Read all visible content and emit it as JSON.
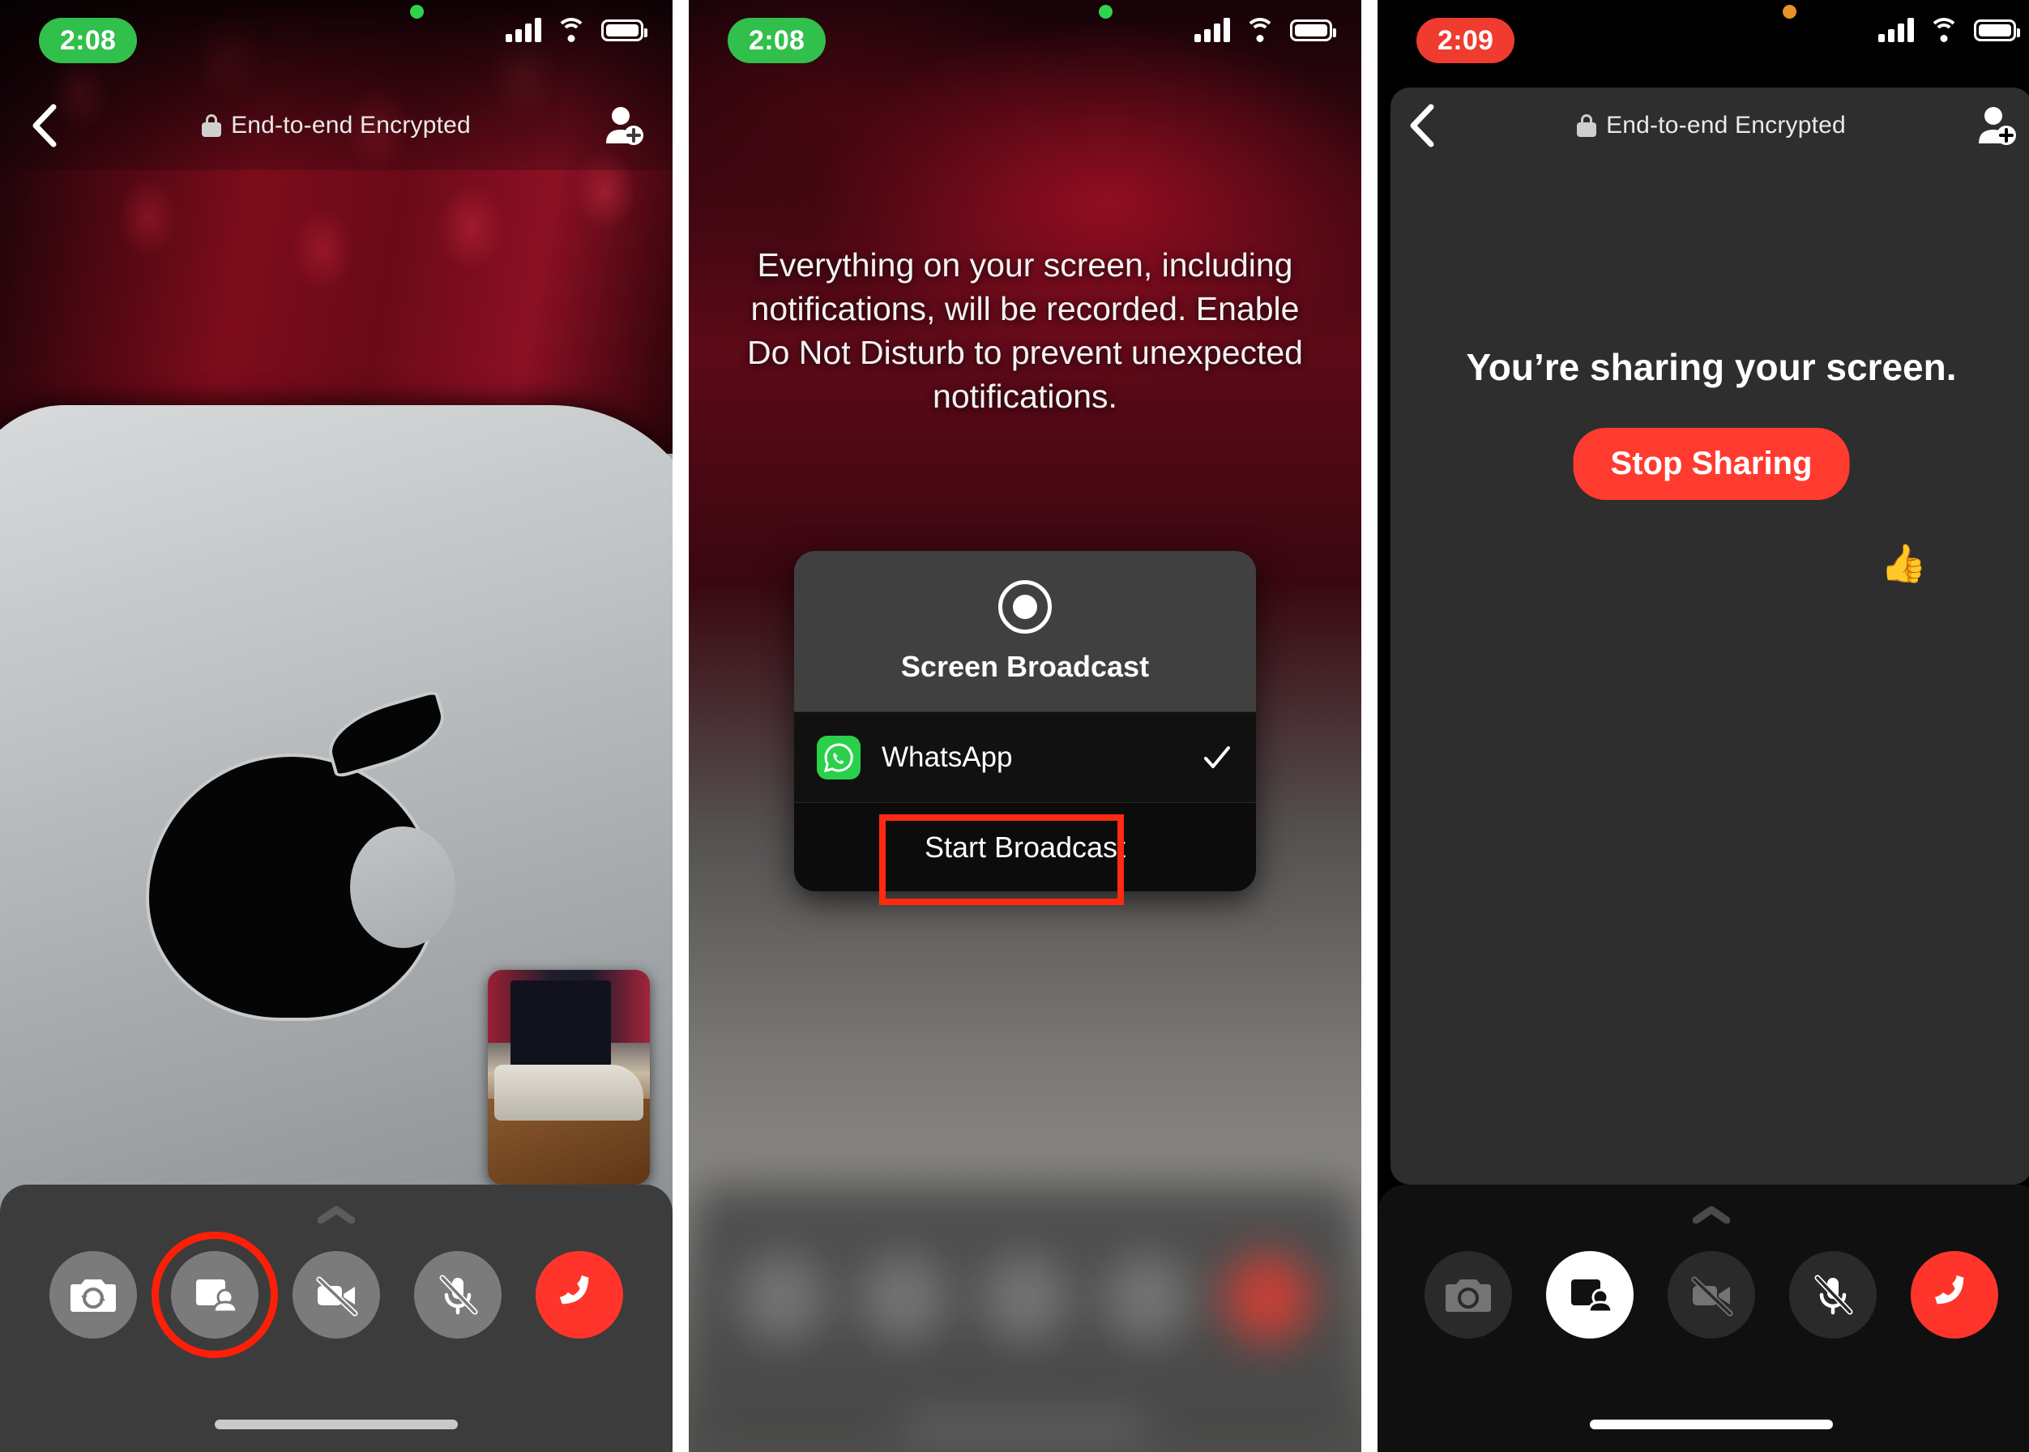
{
  "panels": [
    {
      "id": "call-screen",
      "status": {
        "time": "2:08",
        "time_pill_color": "#31c04b",
        "privacy_dot": "green",
        "icons": [
          "cellular-signal",
          "wifi",
          "battery"
        ]
      },
      "nav": {
        "back": "back-chevron",
        "lock": "lock-icon",
        "title": "End-to-end Encrypted",
        "add": "add-participant-icon"
      },
      "controls": [
        {
          "name": "flip-camera",
          "state": "inactive"
        },
        {
          "name": "share-screen",
          "state": "inactive",
          "highlighted": true
        },
        {
          "name": "video-off",
          "state": "inactive"
        },
        {
          "name": "mic-off",
          "state": "inactive"
        },
        {
          "name": "end-call",
          "state": "danger"
        }
      ]
    },
    {
      "id": "broadcast-sheet",
      "status": {
        "time": "2:08",
        "time_pill_color": "#31c04b",
        "privacy_dot": "green",
        "icons": [
          "cellular-signal",
          "wifi",
          "battery"
        ]
      },
      "warning": "Everything on your screen, including notifications, will be recorded. Enable Do Not Disturb to prevent unexpected notifications.",
      "sheet": {
        "icon": "record-icon",
        "title": "Screen Broadcast",
        "app_row": {
          "icon": "whatsapp-icon",
          "label": "WhatsApp",
          "selected": true,
          "check": "checkmark-icon"
        },
        "start_label": "Start Broadcast",
        "start_highlighted": true
      }
    },
    {
      "id": "sharing-active",
      "status": {
        "time": "2:09",
        "time_pill_color": "#f03b2f",
        "privacy_dot": "orange",
        "icons": [
          "cellular-signal",
          "wifi",
          "battery"
        ]
      },
      "nav": {
        "back": "back-chevron",
        "lock": "lock-icon",
        "title": "End-to-end Encrypted",
        "add": "add-participant-icon"
      },
      "headline": "You’re sharing your screen.",
      "stop_label": "Stop Sharing",
      "emoji": "👍",
      "controls": [
        {
          "name": "flip-camera",
          "state": "disabled"
        },
        {
          "name": "share-screen",
          "state": "active"
        },
        {
          "name": "video-off",
          "state": "disabled"
        },
        {
          "name": "mic-off",
          "state": "inactive"
        },
        {
          "name": "end-call",
          "state": "danger"
        }
      ]
    }
  ]
}
